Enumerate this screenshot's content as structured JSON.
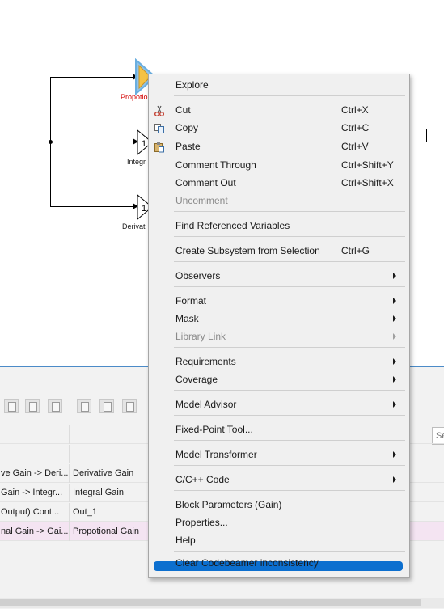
{
  "diagram": {
    "blocks": [
      {
        "label": "Propotio",
        "selected": true
      },
      {
        "label": "Integr",
        "selected": false
      },
      {
        "label": "Derivat",
        "selected": false
      }
    ],
    "gain_glyph": "1"
  },
  "context_menu": {
    "items": [
      {
        "label": "Explore",
        "shortcut": "",
        "submenu": false,
        "disabled": false,
        "icon": ""
      },
      {
        "label": "Cut",
        "shortcut": "Ctrl+X",
        "submenu": false,
        "disabled": false,
        "icon": "scissors-icon"
      },
      {
        "label": "Copy",
        "shortcut": "Ctrl+C",
        "submenu": false,
        "disabled": false,
        "icon": "copy-icon"
      },
      {
        "label": "Paste",
        "shortcut": "Ctrl+V",
        "submenu": false,
        "disabled": false,
        "icon": "paste-icon"
      },
      {
        "label": "Comment Through",
        "shortcut": "Ctrl+Shift+Y",
        "submenu": false,
        "disabled": false,
        "icon": ""
      },
      {
        "label": "Comment Out",
        "shortcut": "Ctrl+Shift+X",
        "submenu": false,
        "disabled": false,
        "icon": ""
      },
      {
        "label": "Uncomment",
        "shortcut": "",
        "submenu": false,
        "disabled": true,
        "icon": ""
      },
      {
        "label": "Find Referenced Variables",
        "shortcut": "",
        "submenu": false,
        "disabled": false,
        "icon": ""
      },
      {
        "label": "Create Subsystem from Selection",
        "shortcut": "Ctrl+G",
        "submenu": false,
        "disabled": false,
        "icon": ""
      },
      {
        "label": "Observers",
        "shortcut": "",
        "submenu": true,
        "disabled": false,
        "icon": ""
      },
      {
        "label": "Format",
        "shortcut": "",
        "submenu": true,
        "disabled": false,
        "icon": ""
      },
      {
        "label": "Mask",
        "shortcut": "",
        "submenu": true,
        "disabled": false,
        "icon": ""
      },
      {
        "label": "Library Link",
        "shortcut": "",
        "submenu": true,
        "disabled": true,
        "icon": ""
      },
      {
        "label": "Requirements",
        "shortcut": "",
        "submenu": true,
        "disabled": false,
        "icon": ""
      },
      {
        "label": "Coverage",
        "shortcut": "",
        "submenu": true,
        "disabled": false,
        "icon": ""
      },
      {
        "label": "Model Advisor",
        "shortcut": "",
        "submenu": true,
        "disabled": false,
        "icon": ""
      },
      {
        "label": "Fixed-Point Tool...",
        "shortcut": "",
        "submenu": false,
        "disabled": false,
        "icon": ""
      },
      {
        "label": "Model Transformer",
        "shortcut": "",
        "submenu": true,
        "disabled": false,
        "icon": ""
      },
      {
        "label": "C/C++ Code",
        "shortcut": "",
        "submenu": true,
        "disabled": false,
        "icon": ""
      },
      {
        "label": "Block Parameters (Gain)",
        "shortcut": "",
        "submenu": false,
        "disabled": false,
        "icon": ""
      },
      {
        "label": "Properties...",
        "shortcut": "",
        "submenu": false,
        "disabled": false,
        "icon": ""
      },
      {
        "label": "Help",
        "shortcut": "",
        "submenu": false,
        "disabled": false,
        "icon": ""
      },
      {
        "label": "Clear Codebeamer inconsistency",
        "shortcut": "",
        "submenu": false,
        "disabled": false,
        "icon": "",
        "highlighted": true
      }
    ]
  },
  "model_data": {
    "search_placeholder": "Se",
    "rows": [
      {
        "source": "",
        "name": ""
      },
      {
        "source": "",
        "name": ""
      },
      {
        "source": "ve Gain -> Deri...",
        "name": "Derivative Gain"
      },
      {
        "source": "Gain -> Integr...",
        "name": "Integral Gain"
      },
      {
        "source": "Output) Cont...",
        "name": "Out_1"
      },
      {
        "source": "nal Gain -> Gai...",
        "name": "Propotional Gain",
        "highlighted": true
      }
    ]
  },
  "colors": {
    "menu_highlight": "#0c6fcf",
    "selected_block_fill": "#f5c244",
    "selected_block_halo": "#8fc3ec",
    "selected_label": "#d40000",
    "panel_accent": "#4b8bc8",
    "highlight_row": "#f4e4f2"
  }
}
